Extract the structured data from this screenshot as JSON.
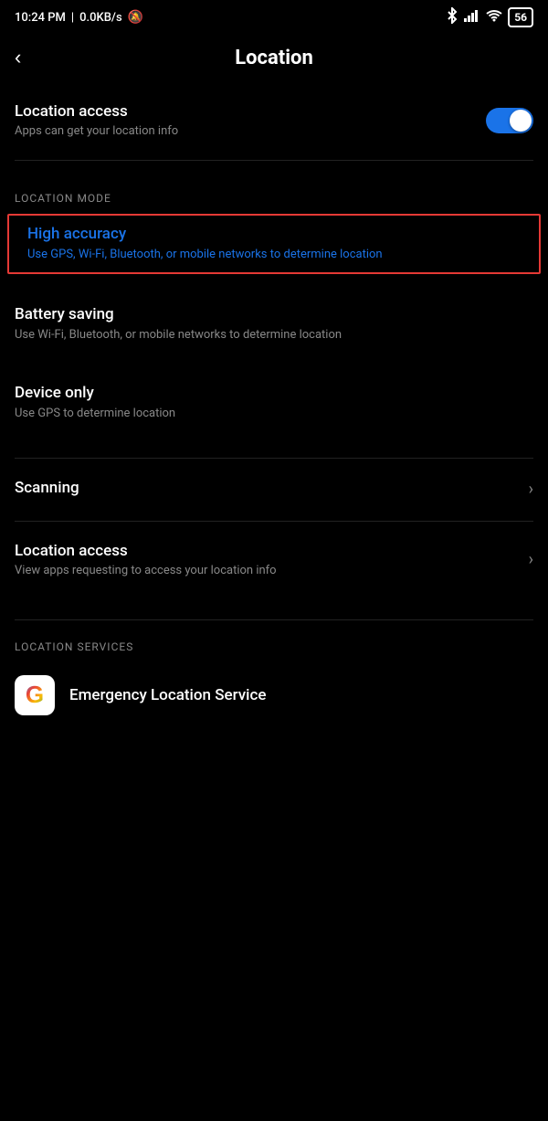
{
  "statusBar": {
    "time": "10:24 PM",
    "network": "0.0KB/s",
    "batteryLevel": "56"
  },
  "header": {
    "backLabel": "‹",
    "title": "Location"
  },
  "locationAccess": {
    "title": "Location access",
    "subtitle": "Apps can get your location info",
    "toggleOn": true
  },
  "locationMode": {
    "sectionLabel": "LOCATION MODE",
    "items": [
      {
        "id": "high-accuracy",
        "title": "High accuracy",
        "description": "Use GPS, Wi-Fi, Bluetooth, or mobile networks to determine location",
        "highlighted": true,
        "selected": true
      },
      {
        "id": "battery-saving",
        "title": "Battery saving",
        "description": "Use Wi-Fi, Bluetooth, or mobile networks to determine location",
        "highlighted": false,
        "selected": false
      },
      {
        "id": "device-only",
        "title": "Device only",
        "description": "Use GPS to determine location",
        "highlighted": false,
        "selected": false
      }
    ]
  },
  "settings": {
    "items": [
      {
        "id": "scanning",
        "title": "Scanning",
        "subtitle": "",
        "hasChevron": true
      },
      {
        "id": "location-access-apps",
        "title": "Location access",
        "subtitle": "View apps requesting to access your location info",
        "hasChevron": true
      }
    ]
  },
  "locationServices": {
    "sectionLabel": "LOCATION SERVICES",
    "items": [
      {
        "id": "emergency-location",
        "title": "Emergency Location Service",
        "iconType": "google"
      }
    ]
  }
}
